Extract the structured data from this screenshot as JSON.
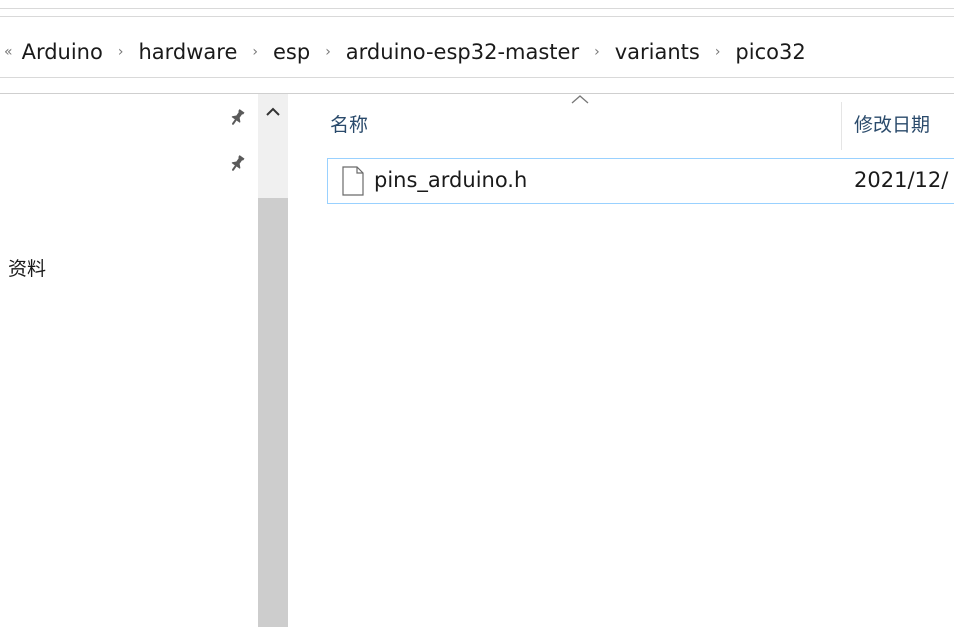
{
  "breadcrumb": {
    "lead_separator": "«",
    "items": [
      "Arduino",
      "hardware",
      "esp",
      "arduino-esp32-master",
      "variants",
      "pico32"
    ],
    "separator": "›"
  },
  "nav": {
    "folder_label": "资料",
    "pin_icon": "pin-icon"
  },
  "file_list": {
    "columns": {
      "name": "名称",
      "date_modified": "修改日期"
    },
    "sort_indicator": "ascending",
    "rows": [
      {
        "name": "pins_arduino.h",
        "date_modified": "2021/12/"
      }
    ]
  },
  "colors": {
    "selection_border": "#99d1ff",
    "header_text": "#2a4a6b",
    "scroll_thumb": "#cdcdcd"
  }
}
